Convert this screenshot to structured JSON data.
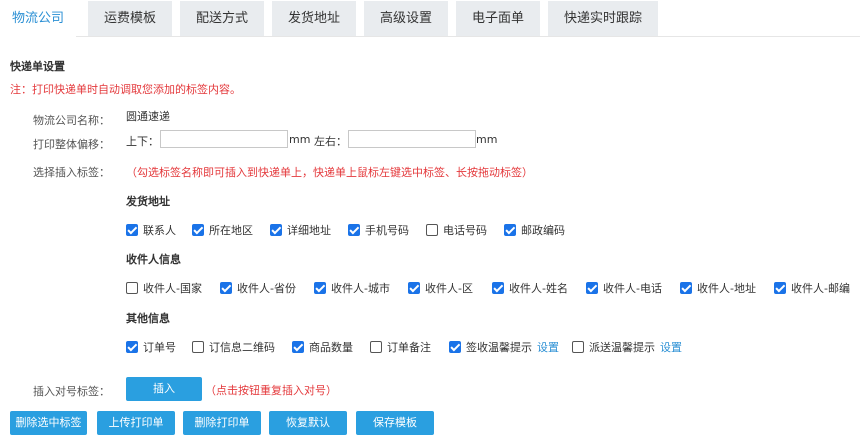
{
  "tabs": [
    {
      "label": "物流公司",
      "active": true
    },
    {
      "label": "运费模板",
      "active": false
    },
    {
      "label": "配送方式",
      "active": false
    },
    {
      "label": "发货地址",
      "active": false
    },
    {
      "label": "高级设置",
      "active": false
    },
    {
      "label": "电子面单",
      "active": false
    },
    {
      "label": "快递实时跟踪",
      "active": false
    }
  ],
  "section_title": "快递单设置",
  "note": "注：打印快递单时自动调取您添加的标签内容。",
  "company": {
    "label": "物流公司名称：",
    "value": "圆通速递"
  },
  "offset": {
    "label": "打印整体偏移：",
    "vertical_label": "上下：",
    "vertical_value": "",
    "unit1": "mm",
    "horizontal_label": "左右：",
    "horizontal_value": "",
    "unit2": "mm"
  },
  "insert_tags": {
    "label": "选择插入标签：",
    "hint": "（勾选标签名称即可插入到快递单上，快递单上鼠标左键选中标签、长按拖动标签）"
  },
  "groups": [
    {
      "title": "发货地址",
      "items": [
        {
          "label": "联系人",
          "checked": true
        },
        {
          "label": "所在地区",
          "checked": true
        },
        {
          "label": "详细地址",
          "checked": true
        },
        {
          "label": "手机号码",
          "checked": true
        },
        {
          "label": "电话号码",
          "checked": false
        },
        {
          "label": "邮政编码",
          "checked": true
        }
      ]
    },
    {
      "title": "收件人信息",
      "items": [
        {
          "label": "收件人-国家",
          "checked": false
        },
        {
          "label": "收件人-省份",
          "checked": true
        },
        {
          "label": "收件人-城市",
          "checked": true
        },
        {
          "label": "收件人-区",
          "checked": true
        },
        {
          "label": "收件人-姓名",
          "checked": true
        },
        {
          "label": "收件人-电话",
          "checked": true
        },
        {
          "label": "收件人-地址",
          "checked": true
        },
        {
          "label": "收件人-邮编",
          "checked": true
        }
      ]
    },
    {
      "title": "其他信息",
      "items": [
        {
          "label": "订单号",
          "checked": true
        },
        {
          "label": "订信息二维码",
          "checked": false
        },
        {
          "label": "商品数量",
          "checked": true
        },
        {
          "label": "订单备注",
          "checked": false
        },
        {
          "label": "签收温馨提示",
          "checked": true,
          "link": "设置"
        },
        {
          "label": "派送温馨提示",
          "checked": false,
          "link": "设置"
        }
      ]
    }
  ],
  "pair_tag": {
    "label": "插入对号标签：",
    "button": "插入",
    "hint": "（点击按钮重复插入对号）"
  },
  "actions": [
    "删除选中标签",
    "上传打印单",
    "删除打印单",
    "恢复默认",
    "保存模板"
  ],
  "colors": {
    "accent": "#2a9fe0",
    "checkbox": "#1a73e8",
    "warning": "#e4393c",
    "tab_inactive": "#e9ecef"
  }
}
